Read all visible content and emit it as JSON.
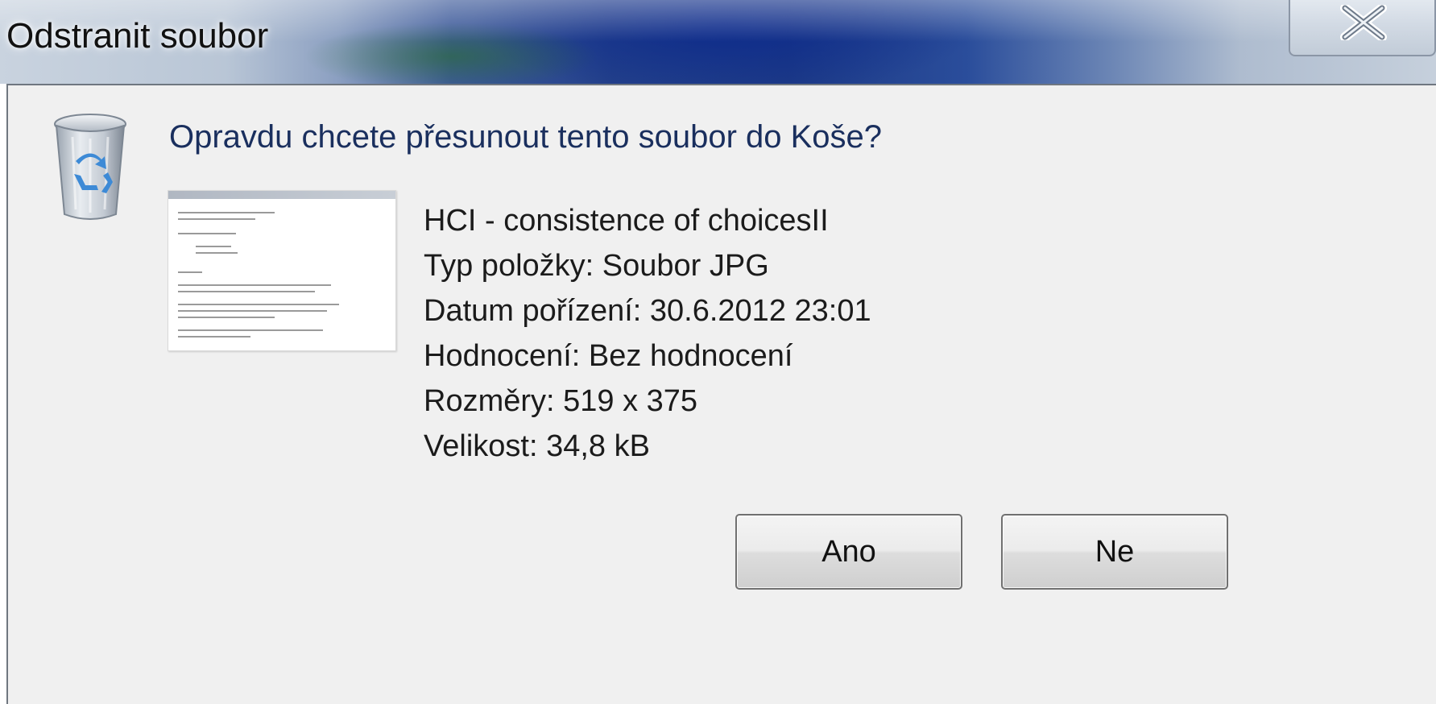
{
  "window": {
    "title": "Odstranit soubor",
    "close_icon": "close-x-icon"
  },
  "dialog": {
    "icon": "recycle-bin-icon",
    "question": "Opravdu chcete přesunout tento soubor do Koše?",
    "file": {
      "name": "HCI - consistence of choicesII",
      "type": "Typ položky: Soubor JPG",
      "date_taken": "Datum pořízení: 30.6.2012 23:01",
      "rating": "Hodnocení: Bez hodnocení",
      "dimensions": "Rozměry: 519 x 375",
      "size": "Velikost: 34,8 kB"
    },
    "buttons": {
      "yes": "Ano",
      "no": "Ne"
    }
  },
  "colors": {
    "question_text": "#1a2f5e",
    "dialog_background": "#f0f0f0",
    "titlebar_blue": "#1d3a86"
  }
}
